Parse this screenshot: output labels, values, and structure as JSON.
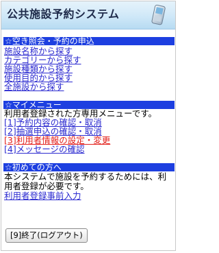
{
  "header": {
    "title": "公共施設予約システム",
    "icon": "mobile-phone-icon"
  },
  "sections": {
    "search": {
      "heading": "☆空き照会・予約の申込",
      "links": [
        "施設名称から探す",
        "カテゴリーから探す",
        "施設種類から探す",
        "使用目的から探す",
        "全施設から探す"
      ]
    },
    "mymenu": {
      "heading": "☆マイメニュー",
      "description": "利用者登録された方専用メニューです。",
      "items": [
        {
          "num": "[1]",
          "label": "予約内容の確認・取消"
        },
        {
          "num": "[2]",
          "label": "抽選申込の確認・取消"
        },
        {
          "num": "[3]",
          "label": "利用者情報の設定・変更"
        },
        {
          "num": "[4]",
          "label": "メッセージの確認"
        }
      ]
    },
    "first": {
      "heading": "☆初めての方へ",
      "description": "本システムで施設を予約するためには、利用者登録が必要です。",
      "link": "利用者登録事前入力"
    }
  },
  "footer": {
    "exit_label": "[9]終了(ログアウト)"
  },
  "colors": {
    "section_bar": "#1d3fe0",
    "link": "#2b2ad0",
    "current_link": "#e3201b",
    "header_bg": "#cfe8f8"
  }
}
